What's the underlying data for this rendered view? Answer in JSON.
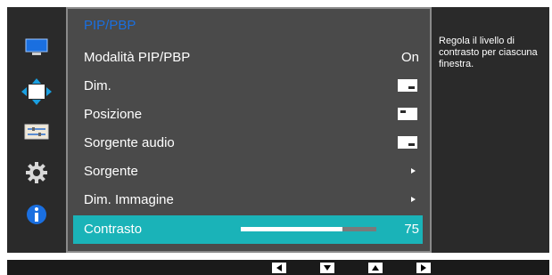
{
  "menu": {
    "title": "PIP/PBP",
    "items": [
      {
        "label": "Modalità PIP/PBP",
        "value": "On"
      },
      {
        "label": "Dim."
      },
      {
        "label": "Posizione"
      },
      {
        "label": "Sorgente audio"
      },
      {
        "label": "Sorgente"
      },
      {
        "label": "Dim. Immagine"
      },
      {
        "label": "Contrasto",
        "value": "75",
        "level": 75
      }
    ]
  },
  "help_text": "Regola il livello di contrasto per ciascuna finestra.",
  "sidebar_icons": [
    "monitor-icon",
    "move-arrows-icon",
    "settings-panel-icon",
    "gear-icon",
    "info-icon"
  ],
  "nav_buttons": [
    "left-arrow-icon",
    "down-arrow-icon",
    "up-arrow-icon",
    "right-arrow-icon"
  ],
  "colors": {
    "accent": "#1ab3b8",
    "title_blue": "#1a6fe0",
    "panel": "#4a4a4a",
    "sidebar": "#2a2a2a"
  }
}
